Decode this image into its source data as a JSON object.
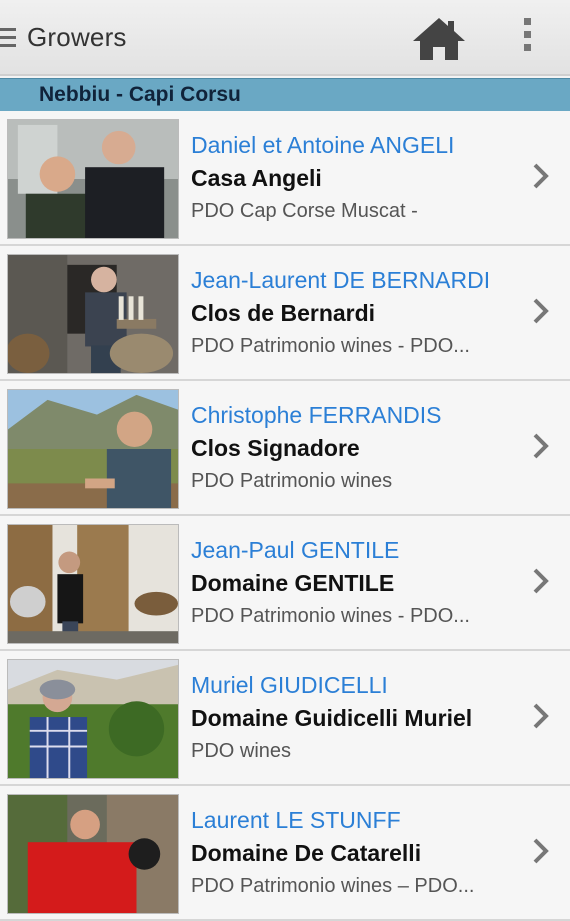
{
  "action_bar": {
    "title": "Growers",
    "icons": [
      "drawer-icon",
      "home-icon",
      "overflow-menu-icon"
    ]
  },
  "section": {
    "title": "Nebbiu - Capi Corsu"
  },
  "growers": [
    {
      "name": "Daniel et Antoine ANGELI",
      "estate": "Casa Angeli",
      "appellation": "PDO Cap Corse Muscat -"
    },
    {
      "name": "Jean-Laurent DE BERNARDI",
      "estate": "Clos de Bernardi",
      "appellation": "PDO Patrimonio wines -  PDO..."
    },
    {
      "name": "Christophe FERRANDIS",
      "estate": "Clos Signadore",
      "appellation": "PDO Patrimonio wines"
    },
    {
      "name": "Jean-Paul GENTILE",
      "estate": "Domaine GENTILE",
      "appellation": "PDO Patrimonio wines -  PDO..."
    },
    {
      "name": "Muriel GIUDICELLI",
      "estate": "Domaine Guidicelli Muriel",
      "appellation": "PDO wines"
    },
    {
      "name": "Laurent LE STUNFF",
      "estate": "Domaine De Catarelli",
      "appellation": "PDO Patrimonio wines –  PDO..."
    }
  ],
  "colors": {
    "grower_name": "#2b7fd6",
    "section_bg": "#6aa8c4",
    "action_bar_bg": "#e8e8e8"
  }
}
